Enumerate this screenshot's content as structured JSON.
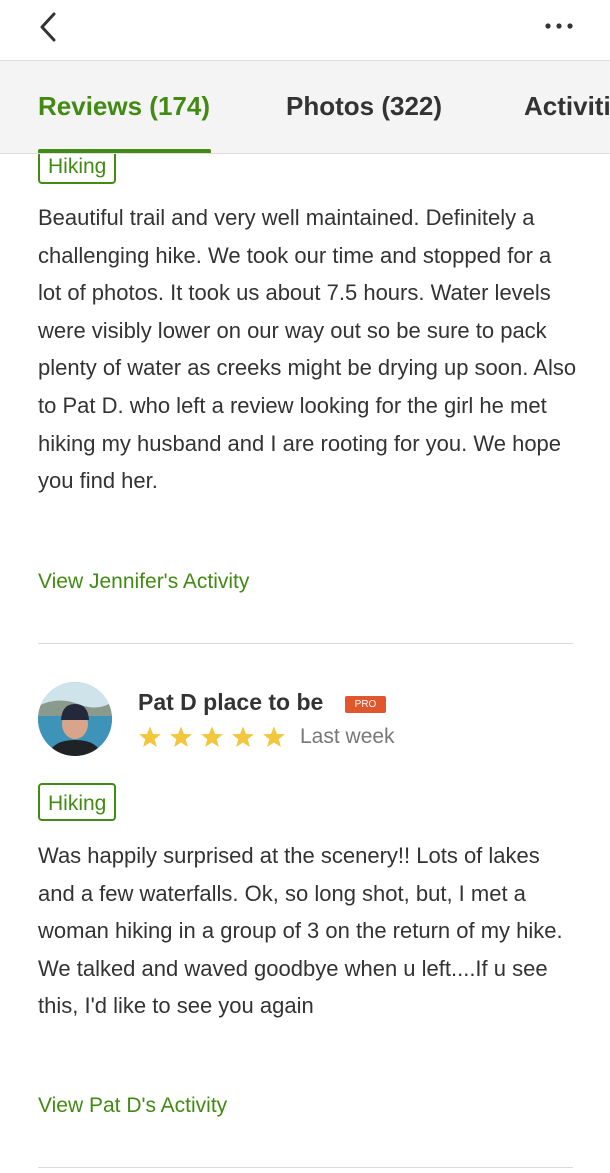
{
  "header": {
    "back_icon": "chevron-left-icon",
    "more_icon": "ellipsis-icon"
  },
  "tabs": [
    {
      "label": "Reviews (174)",
      "active": true
    },
    {
      "label": "Photos (322)",
      "active": false
    },
    {
      "label": "Activiti",
      "active": false
    }
  ],
  "reviews": [
    {
      "tag": "Hiking",
      "text": "Beautiful trail and very well maintained. Definitely a challenging hike. We took our time and stopped for a lot of photos. It took us about 7.5 hours. Water levels were visibly lower on our way out so be sure to pack plenty of water as creeks might be drying up soon. Also to Pat D. who left a review looking for the girl he met hiking my husband and I are rooting for you. We hope you find her.",
      "activity_link": "View Jennifer's Activity"
    },
    {
      "reviewer": "Pat D place to be",
      "badge": "PRO",
      "rating": 5,
      "date": "Last week",
      "tag": "Hiking",
      "text": "Was happily surprised at the scenery!! Lots of lakes and a few waterfalls. Ok, so long shot, but, I met a woman hiking in a group of 3 on the return of my hike. We talked and waved goodbye when u left....If u see this, I'd like to see you again",
      "activity_link": "View Pat D's Activity"
    }
  ],
  "colors": {
    "accent_green": "#428a13",
    "pro_badge": "#e2562d",
    "star": "#f3c73d",
    "text": "#333333"
  }
}
